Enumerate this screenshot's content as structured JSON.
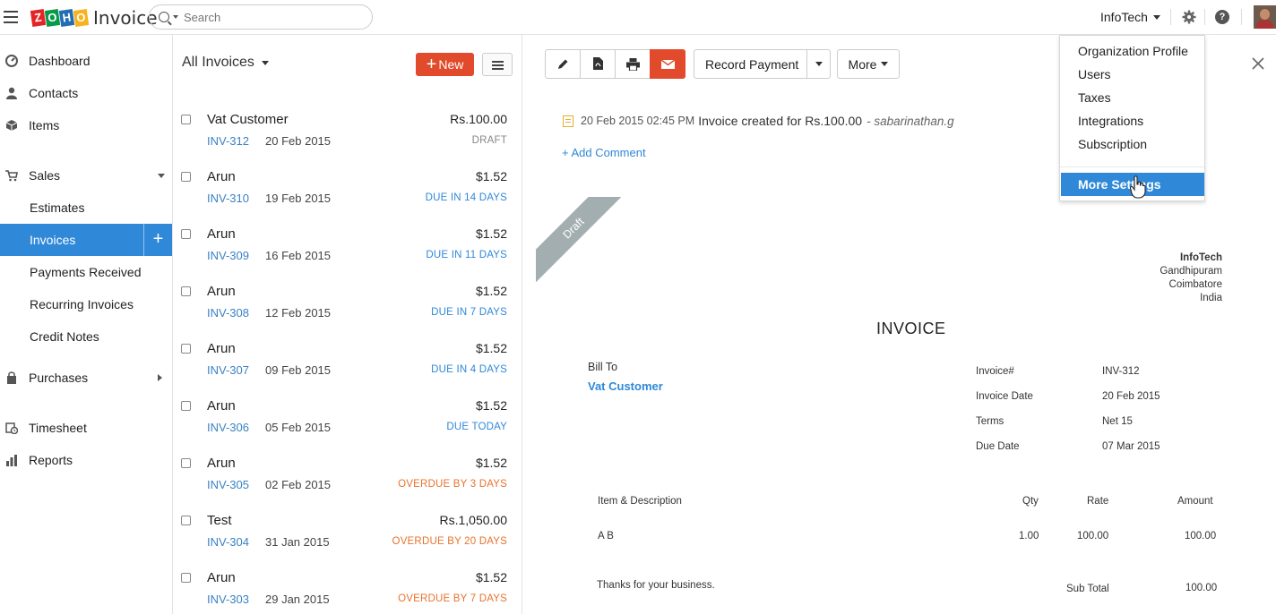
{
  "topbar": {
    "logo_letters": [
      "Z",
      "O",
      "H",
      "O"
    ],
    "logo_colors": [
      "#e42527",
      "#089949",
      "#226db4",
      "#f9b21d"
    ],
    "app_name": "Invoice",
    "search_placeholder": "Search",
    "org_name": "InfoTech",
    "help_label": "?"
  },
  "sidebar": {
    "items": [
      {
        "label": "Dashboard",
        "icon": "dashboard-icon"
      },
      {
        "label": "Contacts",
        "icon": "user-icon"
      },
      {
        "label": "Items",
        "icon": "box-icon"
      },
      {
        "label": "Sales",
        "icon": "cart-icon"
      },
      {
        "label": "Estimates"
      },
      {
        "label": "Invoices",
        "active": true
      },
      {
        "label": "Payments Received"
      },
      {
        "label": "Recurring Invoices"
      },
      {
        "label": "Credit Notes"
      },
      {
        "label": "Purchases",
        "icon": "bag-icon"
      },
      {
        "label": "Timesheet",
        "icon": "clock-icon"
      },
      {
        "label": "Reports",
        "icon": "bar-chart-icon"
      }
    ],
    "add_label": "+"
  },
  "list": {
    "filter_label": "All Invoices",
    "new_label": "New",
    "rows": [
      {
        "name": "Vat Customer",
        "number": "INV-312",
        "date": "20 Feb 2015",
        "amount": "Rs.100.00",
        "status": "DRAFT",
        "status_type": "draft"
      },
      {
        "name": "Arun",
        "number": "INV-310",
        "date": "19 Feb 2015",
        "amount": "$1.52",
        "status": "DUE IN 14 DAYS",
        "status_type": "due"
      },
      {
        "name": "Arun",
        "number": "INV-309",
        "date": "16 Feb 2015",
        "amount": "$1.52",
        "status": "DUE IN 11 DAYS",
        "status_type": "due"
      },
      {
        "name": "Arun",
        "number": "INV-308",
        "date": "12 Feb 2015",
        "amount": "$1.52",
        "status": "DUE IN 7 DAYS",
        "status_type": "due"
      },
      {
        "name": "Arun",
        "number": "INV-307",
        "date": "09 Feb 2015",
        "amount": "$1.52",
        "status": "DUE IN 4 DAYS",
        "status_type": "due"
      },
      {
        "name": "Arun",
        "number": "INV-306",
        "date": "05 Feb 2015",
        "amount": "$1.52",
        "status": "DUE TODAY",
        "status_type": "due"
      },
      {
        "name": "Arun",
        "number": "INV-305",
        "date": "02 Feb 2015",
        "amount": "$1.52",
        "status": "OVERDUE BY 3 DAYS",
        "status_type": "over"
      },
      {
        "name": "Test",
        "number": "INV-304",
        "date": "31 Jan 2015",
        "amount": "Rs.1,050.00",
        "status": "OVERDUE BY 20 DAYS",
        "status_type": "over"
      },
      {
        "name": "Arun",
        "number": "INV-303",
        "date": "29 Jan 2015",
        "amount": "$1.52",
        "status": "OVERDUE BY 7 DAYS",
        "status_type": "over"
      }
    ]
  },
  "detail": {
    "toolbar": {
      "record_payment_label": "Record Payment",
      "more_label": "More"
    },
    "activity": {
      "datetime": "20 Feb 2015 02:45 PM",
      "text": "Invoice created for Rs.100.00",
      "user": "- sabarinathan.g"
    },
    "add_comment_label": "+ Add Comment",
    "ribbon_label": "Draft",
    "org": {
      "name": "InfoTech",
      "line1": "Gandhipuram",
      "line2": "Coimbatore",
      "line3": "India"
    },
    "invoice_title": "INVOICE",
    "bill_to_label": "Bill To",
    "customer_name": "Vat Customer",
    "meta": [
      {
        "label": "Invoice#",
        "value": "INV-312"
      },
      {
        "label": "Invoice Date",
        "value": "20 Feb 2015"
      },
      {
        "label": "Terms",
        "value": "Net 15"
      },
      {
        "label": "Due Date",
        "value": "07 Mar 2015"
      }
    ],
    "table": {
      "headers": {
        "item": "Item & Description",
        "qty": "Qty",
        "rate": "Rate",
        "amount": "Amount"
      },
      "rows": [
        {
          "item": "A B",
          "qty": "1.00",
          "rate": "100.00",
          "amount": "100.00"
        }
      ]
    },
    "notes": "Thanks for your business.",
    "subtotal_label": "Sub Total",
    "subtotal_value": "100.00"
  },
  "dropdown": {
    "items": [
      "Organization Profile",
      "Users",
      "Taxes",
      "Integrations",
      "Subscription"
    ],
    "highlighted": "More Settings"
  }
}
